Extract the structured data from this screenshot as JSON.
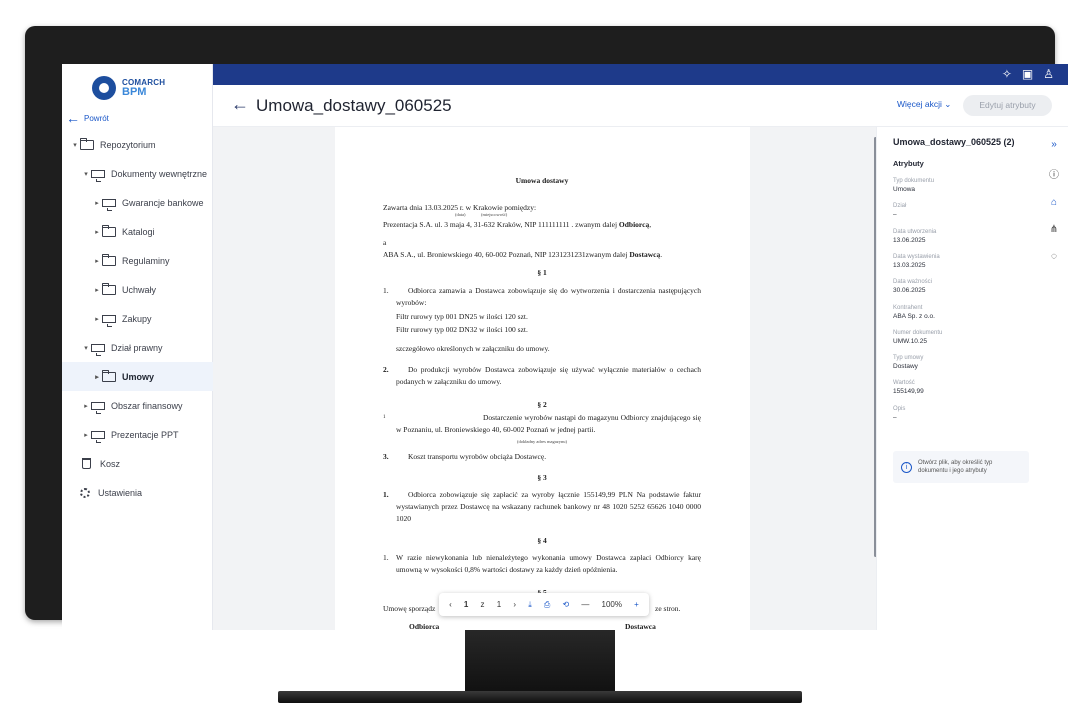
{
  "logo": {
    "line1": "COMARCH",
    "line2": "BPM"
  },
  "sidebar": {
    "back_label": "Powrót",
    "items": [
      {
        "label": "Repozytorium",
        "level": 0,
        "expanded": true,
        "icon": "folder-open-icon"
      },
      {
        "label": "Dokumenty wewnętrzne",
        "level": 1,
        "expanded": true,
        "icon": "server-icon"
      },
      {
        "label": "Gwarancje bankowe",
        "level": 2,
        "icon": "monitor-icon"
      },
      {
        "label": "Katalogi",
        "level": 2,
        "icon": "folder-icon"
      },
      {
        "label": "Regulaminy",
        "level": 2,
        "icon": "folder-icon"
      },
      {
        "label": "Uchwały",
        "level": 2,
        "icon": "folder-icon"
      },
      {
        "label": "Zakupy",
        "level": 2,
        "icon": "monitor-icon"
      },
      {
        "label": "Dział prawny",
        "level": 1,
        "expanded": true,
        "icon": "server-icon"
      },
      {
        "label": "Umowy",
        "level": 2,
        "active": true,
        "icon": "folder-icon"
      },
      {
        "label": "Obszar finansowy",
        "level": 1,
        "icon": "monitor-icon"
      },
      {
        "label": "Prezentacje PPT",
        "level": 1,
        "icon": "monitor-icon"
      },
      {
        "label": "Kosz",
        "level": 0,
        "icon": "trash-icon"
      },
      {
        "label": "Ustawienia",
        "level": 0,
        "icon": "gear-icon"
      }
    ]
  },
  "header": {
    "title": "Umowa_dostawy_060525",
    "more_actions": "Więcej akcji",
    "edit_button": "Edytuj atrybuty"
  },
  "document": {
    "heading": "Umowa dostawy",
    "intro": "Zawarta dnia 13.03.2025 r. w Krakowie pomiędzy:",
    "note_date": "(data)",
    "note_place": "(miejscowość)",
    "party1_a": "Prezentacja S.A. ul. 3 maja 4, 31-632 Kraków, NIP 111111111 . zwanym dalej ",
    "party1_b": "Odbiorcą",
    "and": "a",
    "party2_a": "ABA S.A., ul. Broniewskiego 40, 60-002 Poznań, NIP 1231231231zwanym dalej ",
    "party2_b": "Dostawcą",
    "s1": "§ 1",
    "p1": "Odbiorca zamawia a Dostawca zobowiązuje się do wytworzenia i dostarczenia następujących wyrobów:",
    "p1_item1": "Filtr rurowy typ 001 DN25 w ilości 120 szt.",
    "p1_item2": "Filtr rurowy typ 002 DN32 w ilości 100 szt.",
    "p1_tail": "szczegółowo określonych w załączniku do umowy.",
    "p2": "Do produkcji wyrobów Dostawca zobowiązuje się używać wyłącznie materiałów o cechach podanych w załączniku do umowy.",
    "s2": "§ 2",
    "p3": "Dostarczenie wyrobów nastąpi do magazynu Odbiorcy znajdującego się w      Poznaniu, ul. Broniewskiego 40, 60-002 Poznań  w jednej partii.",
    "note_addr": "(dokładny adres magazynu)",
    "p4": "Koszt transportu wyrobów obciąża Dostawcę.",
    "s3": "§ 3",
    "p5": "Odbiorca zobowiązuje się zapłacić za wyroby łącznie 155149,99 PLN Na podstawie faktur wystawianych przez Dostawcę na wskazany rachunek bankowy nr 48 1020 5252 65626 1040 0000 1020",
    "s4": "§ 4",
    "p6": "W razie niewykonania lub nienależytego wykonania umowy Dostawca zapłaci Odbiorcy karę umowną w wysokości 0,8% wartości dostawy za każdy dzień opóźnienia.",
    "s5": "§ 5",
    "p7_start": "Umowę sporządz",
    "p7_end": "ze stron.",
    "sign1": "Odbiorca",
    "sign2": "Dostawca",
    "num1": "1.",
    "num2": "2.",
    "num3": "3.",
    "num_small": "1"
  },
  "pdf_toolbar": {
    "current_page": "1",
    "separator": "z",
    "total_pages": "1",
    "zoom": "100%"
  },
  "details": {
    "title": "Umowa_dostawy_060525 (2)",
    "section": "Atrybuty",
    "attributes": [
      {
        "label": "Typ dokumentu",
        "value": "Umowa"
      },
      {
        "label": "Dział",
        "value": "–"
      },
      {
        "label": "Data utworzenia",
        "value": "13.06.2025"
      },
      {
        "label": "Data wystawienia",
        "value": "13.03.2025"
      },
      {
        "label": "Data ważności",
        "value": "30.06.2025"
      },
      {
        "label": "Kontrahent",
        "value": "ABA Sp. z o.o."
      },
      {
        "label": "Numer dokumentu",
        "value": "UMW.10.25"
      },
      {
        "label": "Typ umowy",
        "value": "Dostawy"
      },
      {
        "label": "Wartość",
        "value": "155149,99"
      },
      {
        "label": "Opis",
        "value": "–"
      }
    ],
    "info_text": "Otwórz plik, aby określić typ dokumentu i jego atrybuty"
  },
  "colors": {
    "topbar": "#1e3a8a",
    "accent": "#1a57c8",
    "active_bg": "#eef3fb"
  }
}
